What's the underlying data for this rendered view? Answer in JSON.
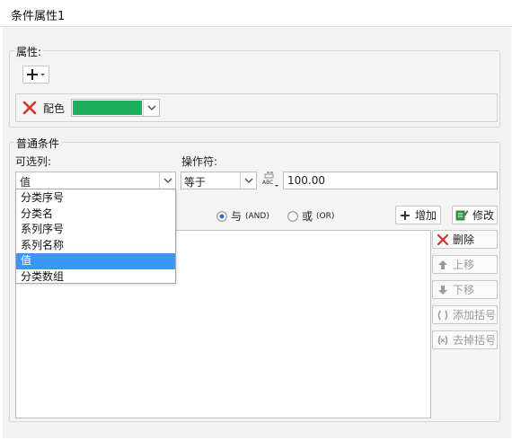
{
  "window": {
    "title": "条件属性1"
  },
  "properties": {
    "group_label": "属性:",
    "add_icon": "plus-icon",
    "color_row": {
      "label": "配色",
      "swatch_color": "#1ead5b",
      "remove_icon": "red-x-icon"
    }
  },
  "conditions": {
    "group_label": "普通条件",
    "column_label": "可选列:",
    "column_value": "值",
    "operator_label": "操作符:",
    "operator_value": "等于",
    "value_input": "100.00",
    "value_type_icon": "abc-formula-icon",
    "logic": {
      "and_label": "与",
      "and_sub": "(AND)",
      "or_label": "或",
      "or_sub": "(OR)",
      "selected": "and"
    },
    "add_label": "增加",
    "modify_label": "修改",
    "side_buttons": {
      "delete": "删除",
      "up": "上移",
      "down": "下移",
      "add_bracket": "添加括号",
      "remove_bracket": "去掉括号"
    },
    "dropdown_options": [
      "分类序号",
      "分类名",
      "系列序号",
      "系列名称",
      "值",
      "分类数组"
    ],
    "dropdown_selected_index": 4
  },
  "colors": {
    "accent": "#3d95f6",
    "swatch": "#1ead5b",
    "delete_red": "#d9302a",
    "modify_green": "#2e9b3c"
  }
}
